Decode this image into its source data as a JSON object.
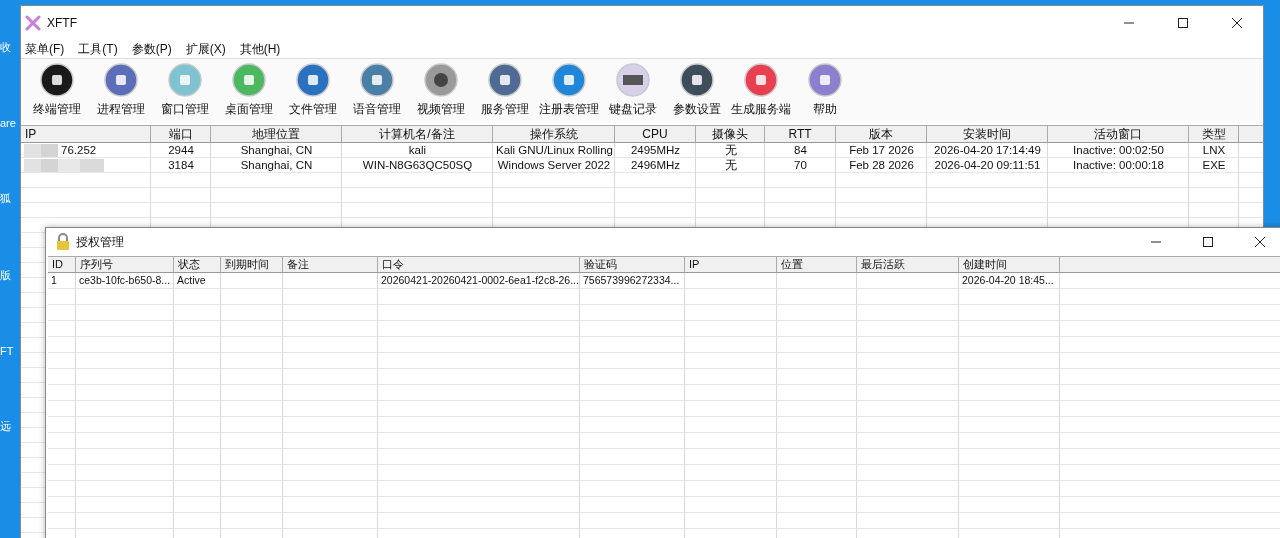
{
  "desktop": {
    "icon_labels": [
      "收",
      "are",
      "狐",
      "版",
      "FT",
      "远"
    ]
  },
  "window": {
    "title": "XFTF"
  },
  "menu": [
    "菜单(F)",
    "工具(T)",
    "参数(P)",
    "扩展(X)",
    "其他(H)"
  ],
  "toolbar": [
    "终端管理",
    "进程管理",
    "窗口管理",
    "桌面管理",
    "文件管理",
    "语音管理",
    "视频管理",
    "服务管理",
    "注册表管理",
    "键盘记录",
    "参数设置",
    "生成服务端",
    "帮助"
  ],
  "table": {
    "columns": [
      "IP",
      "端口",
      "地理位置",
      "计算机名/备注",
      "操作系统",
      "CPU",
      "摄像头",
      "RTT",
      "版本",
      "安装时间",
      "活动窗口",
      "类型"
    ],
    "rows": [
      {
        "ip": "76.252",
        "port": "2944",
        "location": "Shanghai, CN",
        "computer": "kali",
        "os": "Kali GNU/Linux Rolling",
        "cpu": "2495MHz",
        "camera": "无",
        "rtt": "84",
        "version": "Feb 17 2026",
        "installed": "2026-04-20 17:14:49",
        "active_window": "Inactive: 00:02:50",
        "type": "LNX"
      },
      {
        "ip": "",
        "port": "3184",
        "location": "Shanghai, CN",
        "computer": "WIN-N8G63QC50SQ",
        "os": "Windows Server 2022",
        "cpu": "2496MHz",
        "camera": "无",
        "rtt": "70",
        "version": "Feb 28 2026",
        "installed": "2026-04-20 09:11:51",
        "active_window": "Inactive: 00:00:18",
        "type": "EXE"
      }
    ]
  },
  "license_window": {
    "title": "授权管理",
    "columns": [
      "ID",
      "序列号",
      "状态",
      "到期时间",
      "备注",
      "口令",
      "验证码",
      "IP",
      "位置",
      "最后活跃",
      "创建时间"
    ],
    "rows": [
      [
        "1",
        "ce3b-10fc-b650-8...",
        "Active",
        "",
        "",
        "20260421-20260421-0002-6ea1-f2c8-26...",
        "756573996272334...",
        "",
        "",
        "",
        "2026-04-20 18:45..."
      ]
    ]
  }
}
